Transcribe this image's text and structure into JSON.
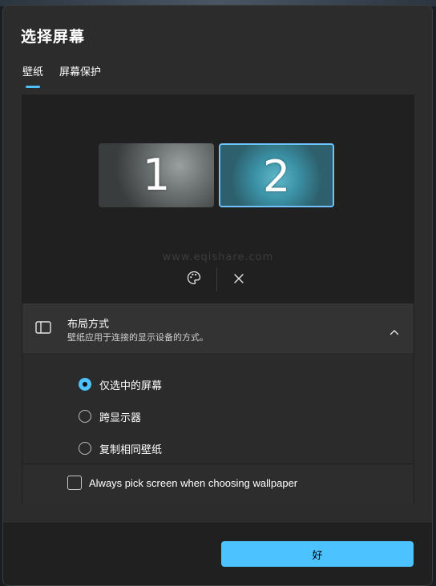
{
  "dialog": {
    "title": "选择屏幕",
    "tabs": [
      {
        "label": "壁纸",
        "active": true
      },
      {
        "label": "屏幕保护",
        "active": false
      }
    ]
  },
  "preview": {
    "monitors": [
      {
        "number": "1",
        "selected": false
      },
      {
        "number": "2",
        "selected": true
      }
    ],
    "watermark": "www.eqishare.com",
    "actions": [
      {
        "icon": "palette-icon"
      },
      {
        "icon": "close-icon"
      }
    ]
  },
  "layout_card": {
    "icon": "sidebar-layout-icon",
    "title": "布局方式",
    "subtitle": "壁纸应用于连接的显示设备的方式。",
    "expanded": true,
    "options": [
      {
        "label": "仅选中的屏幕",
        "selected": true
      },
      {
        "label": "跨显示器",
        "selected": false
      },
      {
        "label": "复制相同壁纸",
        "selected": false
      }
    ],
    "checkbox": {
      "label": "Always pick screen when choosing wallpaper",
      "checked": false
    }
  },
  "footer": {
    "ok_label": "好"
  },
  "colors": {
    "accent": "#4cc2ff",
    "dialog_bg": "#2c2c2c",
    "preview_bg": "#202020"
  }
}
